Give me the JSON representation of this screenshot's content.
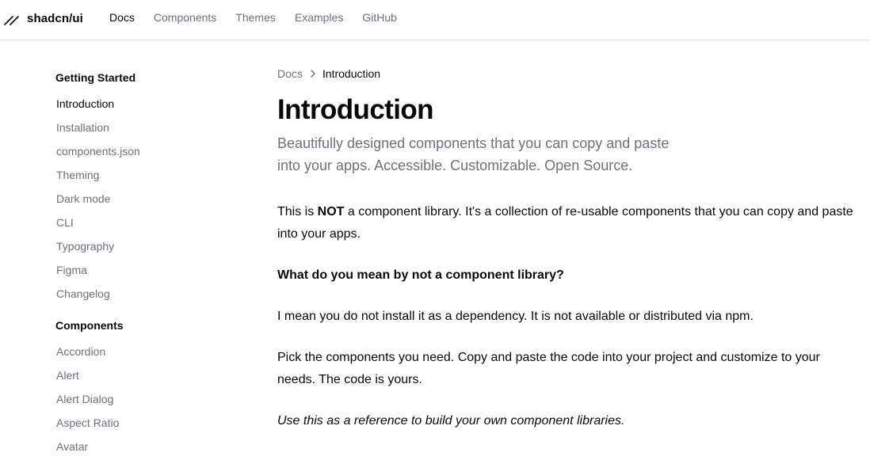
{
  "header": {
    "brand": "shadcn/ui",
    "nav": [
      {
        "label": "Docs",
        "active": true
      },
      {
        "label": "Components",
        "active": false
      },
      {
        "label": "Themes",
        "active": false
      },
      {
        "label": "Examples",
        "active": false
      },
      {
        "label": "GitHub",
        "active": false
      }
    ]
  },
  "sidebar": {
    "sections": [
      {
        "title": "Getting Started",
        "items": [
          "Introduction",
          "Installation",
          "components.json",
          "Theming",
          "Dark mode",
          "CLI",
          "Typography",
          "Figma",
          "Changelog"
        ]
      },
      {
        "title": "Components",
        "items": [
          "Accordion",
          "Alert",
          "Alert Dialog",
          "Aspect Ratio",
          "Avatar"
        ]
      }
    ],
    "active_item": "Introduction"
  },
  "main": {
    "breadcrumb": {
      "parent": "Docs",
      "current": "Introduction"
    },
    "title": "Introduction",
    "subtitle": "Beautifully designed components that you can copy and paste into your apps. Accessible. Customizable. Open Source.",
    "p1_before": "This is ",
    "p1_strong": "NOT",
    "p1_after": " a component library. It's a collection of re-usable components that you can copy and paste into your apps.",
    "question": "What do you mean by not a component library?",
    "p2": "I mean you do not install it as a dependency. It is not available or distributed via npm.",
    "p3": "Pick the components you need. Copy and paste the code into your project and customize to your needs. The code is yours.",
    "p4": "Use this as a reference to build your own component libraries."
  },
  "icons": {
    "logo": "slash-logo-icon",
    "breadcrumb_separator": "chevron-right-icon"
  },
  "colors": {
    "foreground": "#09090b",
    "muted": "#71717a",
    "border": "#e4e4e7",
    "background": "#ffffff"
  }
}
